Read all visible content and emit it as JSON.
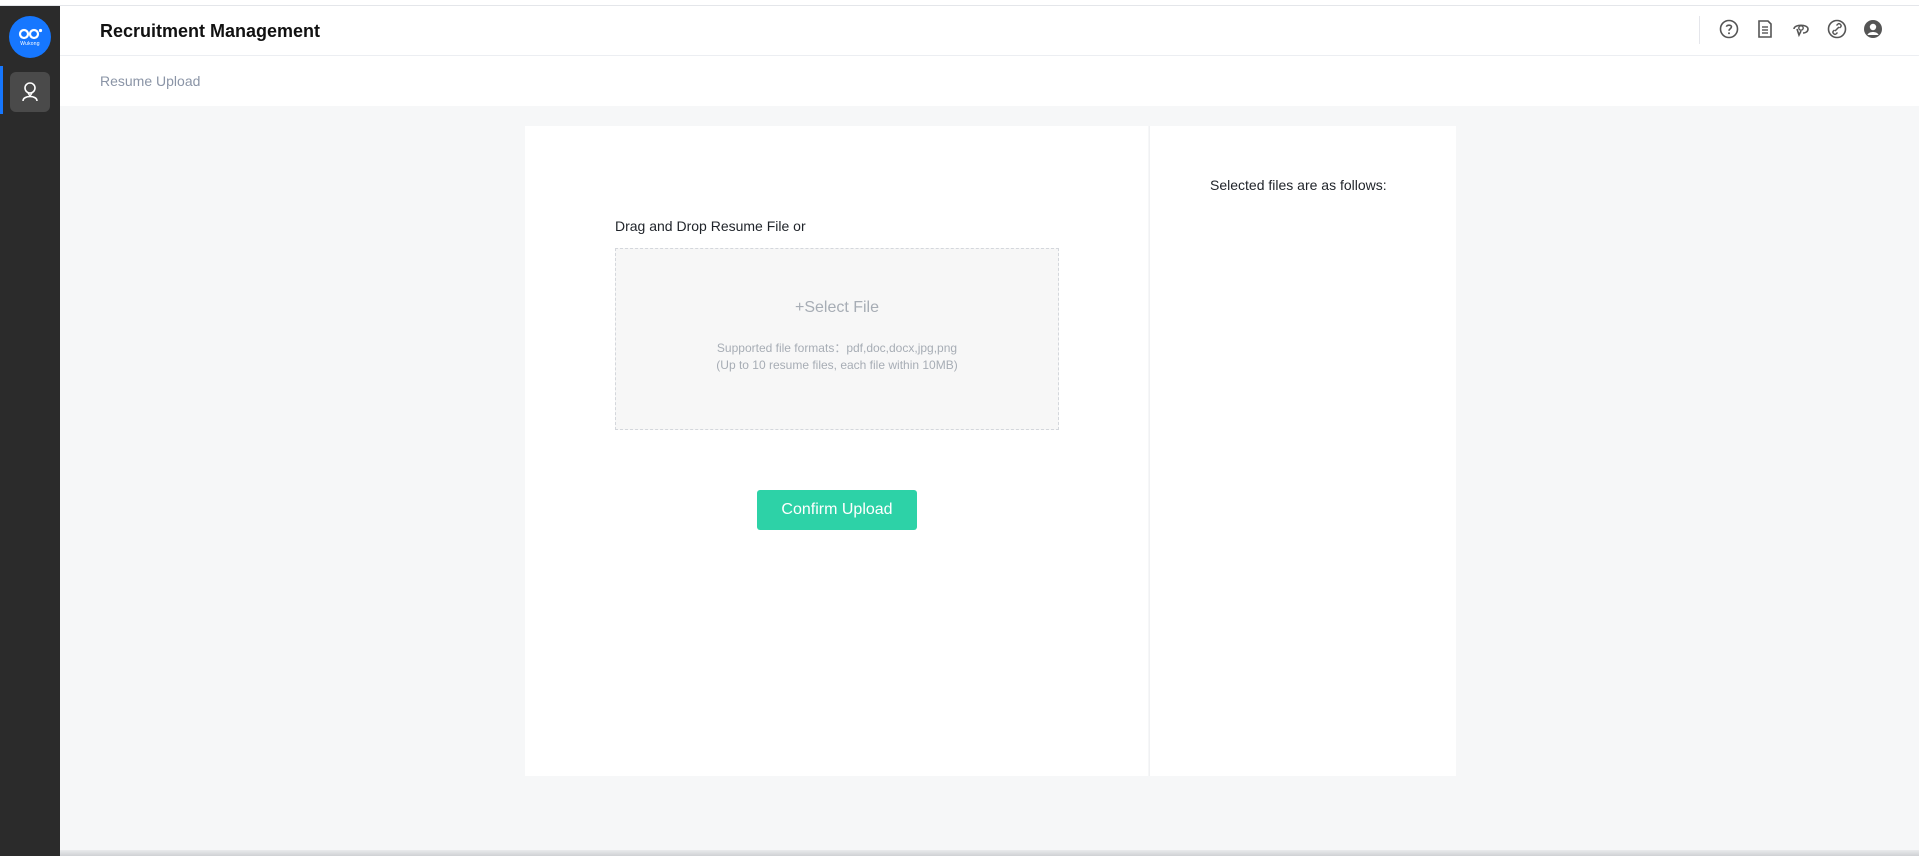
{
  "app": {
    "title": "Recruitment Management",
    "logo_text": "Wukong"
  },
  "sidebar": {
    "items": [
      {
        "name": "recruitment",
        "icon": "person-icon",
        "active": true
      }
    ]
  },
  "header": {
    "icons": [
      "help-icon",
      "document-icon",
      "support-icon",
      "link-icon",
      "user-avatar-icon"
    ]
  },
  "breadcrumb": {
    "current": "Resume Upload"
  },
  "upload": {
    "drag_label": "Drag and Drop Resume File or",
    "select_file": "+Select File",
    "formats_line": "Supported file formats：pdf,doc,docx,jpg,png",
    "limit_line": "(Up to 10 resume files, each file within 10MB)",
    "confirm_button": "Confirm Upload"
  },
  "selected": {
    "title": "Selected files are as follows:"
  },
  "colors": {
    "accent": "#1677ff",
    "confirm": "#2dd2a7",
    "sidebar": "#2b2b2b"
  }
}
